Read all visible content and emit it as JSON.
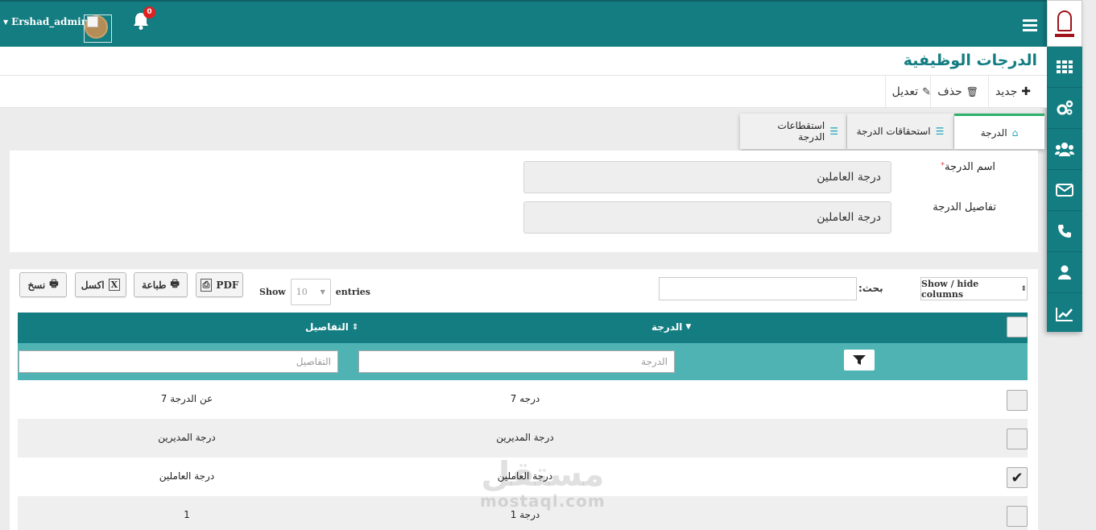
{
  "header": {
    "username": "Ershad_admin",
    "notification_count": "0"
  },
  "page": {
    "title": "الدرجات الوظيفية"
  },
  "toolbar": {
    "new_label": "جديد",
    "delete_label": "حذف",
    "edit_label": "تعديل"
  },
  "tabs": [
    {
      "label": "الدرجة",
      "icon": "home-icon"
    },
    {
      "label": "استحقاقات الدرجة",
      "icon": "list-icon"
    },
    {
      "label": "استقطاعات الدرجة",
      "icon": "list-icon"
    }
  ],
  "form": {
    "name_label": "اسم الدرجة",
    "name_required": "*",
    "name_value": "درجة العاملين",
    "details_label": "تفاصيل الدرجة",
    "details_value": "درجة العاملين"
  },
  "table_tools": {
    "copy_label": "نسخ",
    "excel_label": "اكسل",
    "print_label": "طباعة",
    "pdf_label": "PDF",
    "show_label": "Show",
    "entries_value": "10",
    "entries_label": "entries",
    "search_label": "بحث:",
    "colvis_label": "Show / hide columns"
  },
  "table": {
    "columns": [
      "الدرجة",
      "التفاصيل"
    ],
    "filter_placeholders": [
      "الدرجة",
      "التفاصيل"
    ],
    "rows": [
      {
        "grade": "درجه 7",
        "details": "عن الدرجة 7",
        "checked": false
      },
      {
        "grade": "درجة المديرين",
        "details": "درجة المديرين",
        "checked": false
      },
      {
        "grade": "درجة العاملين",
        "details": "درجة العاملين",
        "checked": true
      },
      {
        "grade": "درجة 1",
        "details": "1",
        "checked": false
      }
    ]
  },
  "watermark": {
    "arabic": "مستقل",
    "latin": "mostaql.com"
  },
  "colors": {
    "primary": "#137d82",
    "filter_row": "#4fb3b3",
    "tab_active": "#2db06a",
    "badge": "#e02020"
  }
}
